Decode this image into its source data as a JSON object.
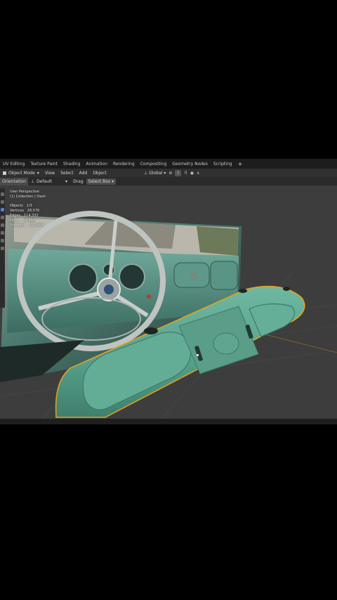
{
  "workspace_tabs": [
    "UV Editing",
    "Texture Paint",
    "Shading",
    "Animation",
    "Rendering",
    "Compositing",
    "Geometry Nodes",
    "Scripting",
    "+"
  ],
  "header": {
    "mode": "Object Mode",
    "menus": [
      "View",
      "Select",
      "Add",
      "Object"
    ],
    "transform_orientation": "Global"
  },
  "tool_settings": {
    "orientation_label": "Orientation",
    "orientation_value": "Default",
    "drag_label": "Drag",
    "drag_value": "Select Box"
  },
  "viewport_overlay": {
    "view_name": "User Perspective",
    "collection": "(1) Collection | Dash",
    "stats": [
      {
        "label": "Objects",
        "value": "1/3"
      },
      {
        "label": "Vertices",
        "value": "28,576"
      },
      {
        "label": "Edges",
        "value": "114,332"
      },
      {
        "label": "Faces",
        "value": "56,864"
      },
      {
        "label": "Triangles",
        "value": "113,408"
      }
    ]
  },
  "colors": {
    "dashboard_teal": "#5aa590",
    "selection_outline": "#e8a21a",
    "viewport_bg": "#3d3d3d",
    "header_bg": "#303030"
  }
}
